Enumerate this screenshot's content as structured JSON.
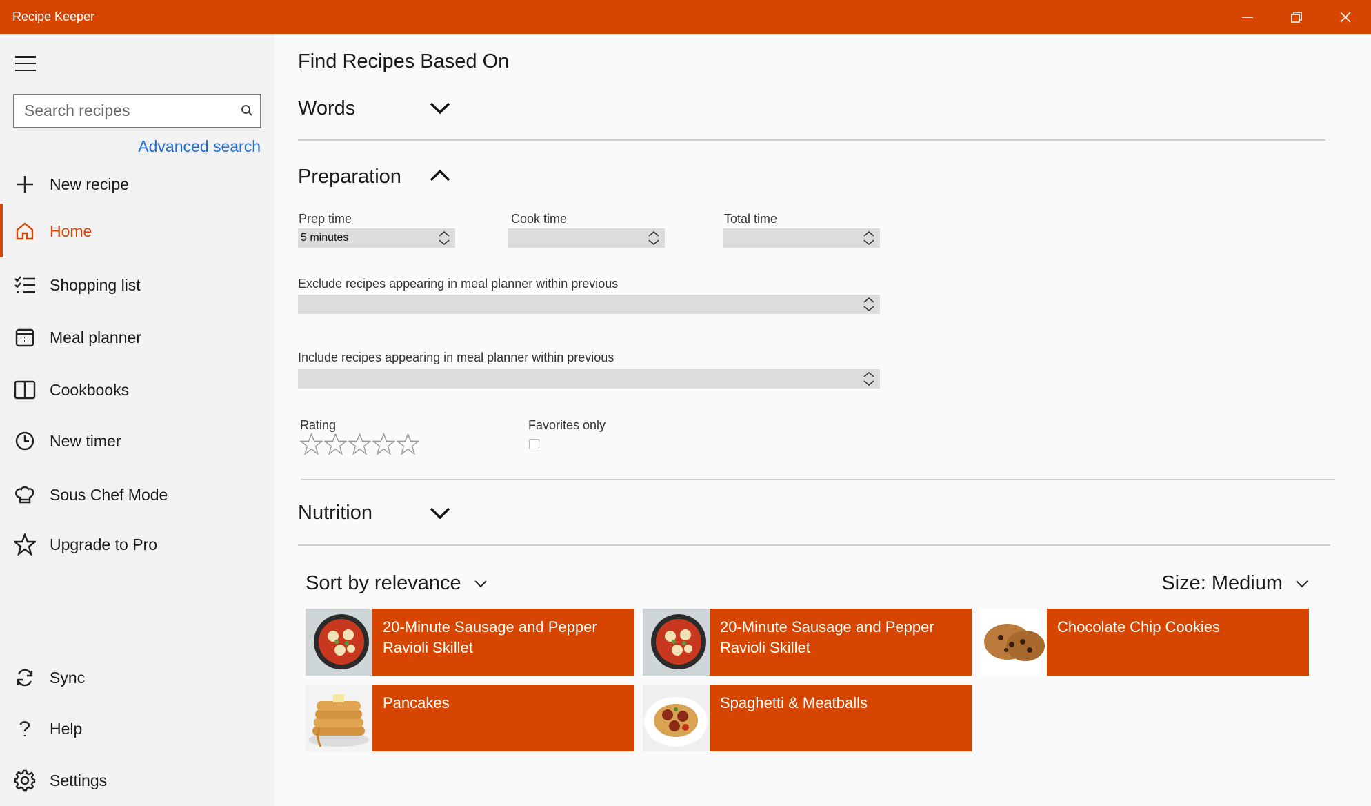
{
  "window": {
    "title": "Recipe Keeper",
    "accent_color": "#d64600"
  },
  "sidebar": {
    "search_placeholder": "Search recipes",
    "advanced_search": "Advanced search",
    "items": [
      {
        "label": "New recipe",
        "icon": "plus-icon"
      },
      {
        "label": "Home",
        "icon": "home-icon",
        "active": true
      },
      {
        "label": "Shopping list",
        "icon": "checklist-icon"
      },
      {
        "label": "Meal planner",
        "icon": "calendar-icon"
      },
      {
        "label": "Cookbooks",
        "icon": "book-icon"
      },
      {
        "label": "New timer",
        "icon": "clock-icon"
      },
      {
        "label": "Sous Chef Mode",
        "icon": "chef-hat-icon"
      },
      {
        "label": "Upgrade to Pro",
        "icon": "star-icon"
      }
    ],
    "bottom_items": [
      {
        "label": "Sync",
        "icon": "sync-icon"
      },
      {
        "label": "Help",
        "icon": "help-icon"
      },
      {
        "label": "Settings",
        "icon": "gear-icon"
      }
    ]
  },
  "main": {
    "title": "Find Recipes Based On",
    "sections": {
      "words": {
        "label": "Words",
        "expanded": false
      },
      "preparation": {
        "label": "Preparation",
        "expanded": true
      },
      "nutrition": {
        "label": "Nutrition",
        "expanded": false
      }
    },
    "preparation": {
      "prep_time_label": "Prep time",
      "prep_time_value": "5 minutes",
      "cook_time_label": "Cook time",
      "cook_time_value": "",
      "total_time_label": "Total time",
      "total_time_value": "",
      "exclude_label": "Exclude recipes appearing in meal planner within previous",
      "exclude_value": "",
      "include_label": "Include recipes appearing in meal planner within previous",
      "include_value": "",
      "rating_label": "Rating",
      "rating_value": 0,
      "rating_max": 5,
      "favorites_label": "Favorites only",
      "favorites_checked": false
    },
    "sort_label": "Sort by relevance",
    "size_label": "Size: Medium",
    "recipes": [
      {
        "title": "20-Minute Sausage and Pepper Ravioli Skillet",
        "thumb": "skillet-image"
      },
      {
        "title": "20-Minute Sausage and Pepper Ravioli Skillet",
        "thumb": "skillet-image"
      },
      {
        "title": "Chocolate Chip Cookies",
        "thumb": "cookies-image"
      },
      {
        "title": "Pancakes",
        "thumb": "pancakes-image"
      },
      {
        "title": "Spaghetti & Meatballs",
        "thumb": "spaghetti-image"
      }
    ]
  }
}
